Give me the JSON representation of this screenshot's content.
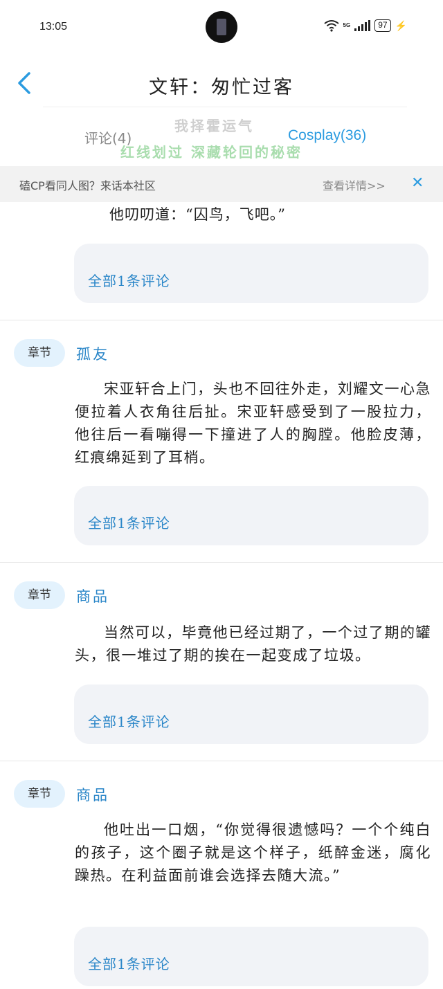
{
  "status_bar": {
    "time": "13:05",
    "network_label": "5G",
    "battery": "97"
  },
  "header": {
    "title": "文轩：匆忙过客"
  },
  "tabs": {
    "comments": "评论(4)",
    "cosplay": "Cosplay(36)"
  },
  "watermark": {
    "line1": "我择霍运气",
    "line2": "红线划过 深藏轮回的秘密"
  },
  "banner": {
    "text": "磕CP看同人图？来话本社区",
    "more": "查看详情>>",
    "close": "✕"
  },
  "top_quote": "他叨叨道：“囚鸟，飞吧。”",
  "all_comments_label": "全部1条评论",
  "chapters": [
    {
      "tag": "章节",
      "title": "孤友",
      "text": "宋亚轩合上门，头也不回往外走，刘耀文一心急便拉着人衣角往后扯。宋亚轩感受到了一股拉力，他往后一看嘣得一下撞进了人的胸膛。他脸皮薄，红痕绵延到了耳梢。",
      "comment_label": "全部1条评论"
    },
    {
      "tag": "章节",
      "title": "商品",
      "text": "当然可以，毕竟他已经过期了，一个过了期的罐头，很一堆过了期的挨在一起变成了垃圾。",
      "comment_label": "全部1条评论"
    },
    {
      "tag": "章节",
      "title": "商品",
      "text": "他吐出一口烟，“你觉得很遗憾吗？一个个纯白的孩子，这个圈子就是这个样子，纸醉金迷，腐化躁热。在利益面前谁会选择去随大流。”",
      "comment_label": "全部1条评论"
    }
  ]
}
